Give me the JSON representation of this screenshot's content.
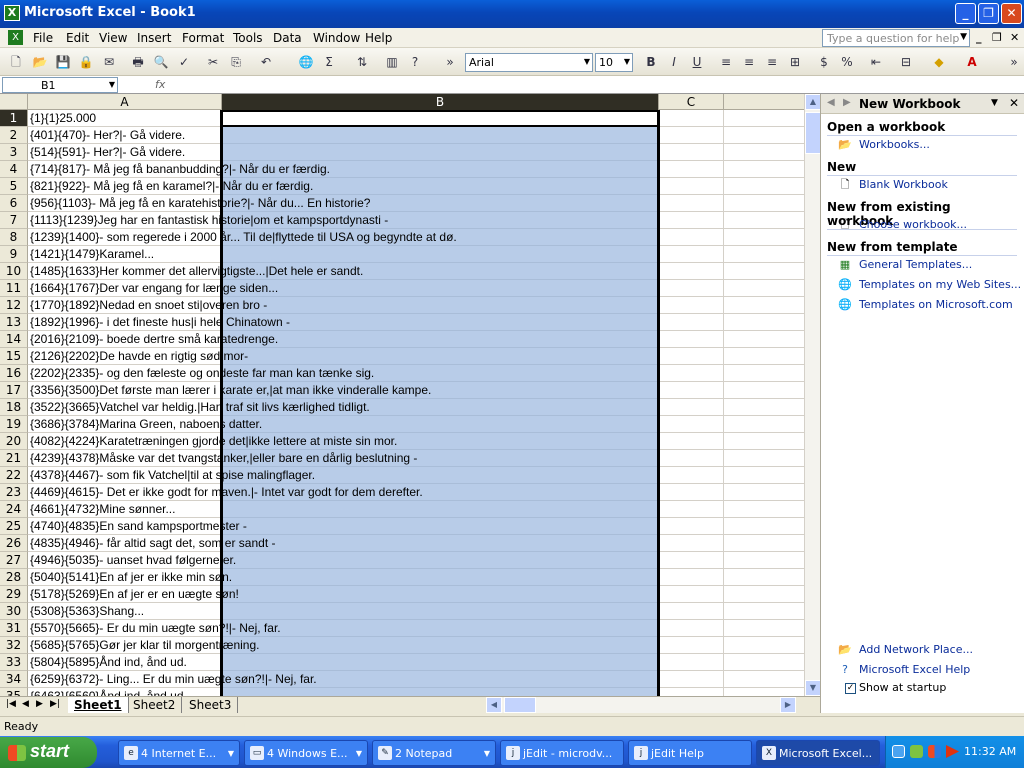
{
  "window": {
    "title": "Microsoft Excel - Book1"
  },
  "menu": [
    "File",
    "Edit",
    "View",
    "Insert",
    "Format",
    "Tools",
    "Data",
    "Window",
    "Help"
  ],
  "help_placeholder": "Type a question for help",
  "toolbar": {
    "font": "Arial",
    "size": "10"
  },
  "formula": {
    "cell": "B1"
  },
  "columns": [
    "A",
    "B",
    "C"
  ],
  "rows": [
    {
      "n": "1",
      "a": "{1}{1}25.000"
    },
    {
      "n": "2",
      "a": "{401}{470}- Her?|- Gå videre."
    },
    {
      "n": "3",
      "a": "{514}{591}- Her?|- Gå videre."
    },
    {
      "n": "4",
      "a": "{714}{817}- Må jeg få bananbudding?|- Når du er færdig."
    },
    {
      "n": "5",
      "a": "{821}{922}- Må jeg få en karamel?|- Når du er færdig."
    },
    {
      "n": "6",
      "a": "{956}{1103}- Må jeg få en karatehistorie?|- Når du... En historie?"
    },
    {
      "n": "7",
      "a": "{1113}{1239}Jeg har en fantastisk historie|om et kampsportdynasti -"
    },
    {
      "n": "8",
      "a": "{1239}{1400}- som regerede i 2000 år... Til de|flyttede til USA og begyndte at dø."
    },
    {
      "n": "9",
      "a": "{1421}{1479}Karamel..."
    },
    {
      "n": "10",
      "a": "{1485}{1633}Her kommer det allervigtigste...|Det hele er sandt."
    },
    {
      "n": "11",
      "a": "{1664}{1767}Der var engang for længe siden..."
    },
    {
      "n": "12",
      "a": "{1770}{1892}Nedad en snoet sti|overen bro -"
    },
    {
      "n": "13",
      "a": "{1892}{1996}- i det fineste hus|i hele Chinatown -"
    },
    {
      "n": "14",
      "a": "{2016}{2109}- boede dertre små karatedrenge."
    },
    {
      "n": "15",
      "a": "{2126}{2202}De havde en rigtig sød mor-"
    },
    {
      "n": "16",
      "a": "{2202}{2335}- og den fæleste og ondeste far man kan tænke sig."
    },
    {
      "n": "17",
      "a": "{3356}{3500}Det første man lærer i karate er,|at man ikke vinderalle kampe."
    },
    {
      "n": "18",
      "a": "{3522}{3665}Vatchel var heldig.|Han traf sit livs kærlighed tidligt."
    },
    {
      "n": "19",
      "a": "{3686}{3784}Marina Green, naboens datter."
    },
    {
      "n": "20",
      "a": "{4082}{4224}Karatetræningen gjorde det|ikke lettere at miste sin mor."
    },
    {
      "n": "21",
      "a": "{4239}{4378}Måske var det tvangstanker,|eller bare en dårlig beslutning -"
    },
    {
      "n": "22",
      "a": "{4378}{4467}- som fik Vatchel|til at spise malingflager."
    },
    {
      "n": "23",
      "a": "{4469}{4615}- Det er ikke godt for maven.|- Intet var godt for dem derefter."
    },
    {
      "n": "24",
      "a": "{4661}{4732}Mine sønner..."
    },
    {
      "n": "25",
      "a": "{4740}{4835}En sand kampsportmester -"
    },
    {
      "n": "26",
      "a": "{4835}{4946}- får altid sagt det, som er sandt -"
    },
    {
      "n": "27",
      "a": "{4946}{5035}- uanset hvad følgerne er."
    },
    {
      "n": "28",
      "a": "{5040}{5141}En af jer er ikke min søn."
    },
    {
      "n": "29",
      "a": "{5178}{5269}En af jer er en uægte søn!"
    },
    {
      "n": "30",
      "a": "{5308}{5363}Shang..."
    },
    {
      "n": "31",
      "a": "{5570}{5665}- Er du min uægte søn?!|- Nej, far."
    },
    {
      "n": "32",
      "a": "{5685}{5765}Gør jer klar til morgentræning."
    },
    {
      "n": "33",
      "a": "{5804}{5895}Ånd ind, ånd ud."
    },
    {
      "n": "34",
      "a": "{6259}{6372}- Ling... Er du min uægte søn?!|- Nej, far."
    },
    {
      "n": "35",
      "a": "{6463}{6560}Ånd ind, ånd ud."
    }
  ],
  "sheets": [
    "Sheet1",
    "Sheet2",
    "Sheet3"
  ],
  "status": "Ready",
  "taskpane": {
    "title": "New Workbook",
    "open_heading": "Open a workbook",
    "open_link": "Workbooks...",
    "new_heading": "New",
    "new_link": "Blank Workbook",
    "existing_heading": "New from existing workbook",
    "existing_link": "Choose workbook...",
    "template_heading": "New from template",
    "template_links": [
      "General Templates...",
      "Templates on my Web Sites...",
      "Templates on Microsoft.com"
    ],
    "bottom_links": [
      "Add Network Place...",
      "Microsoft Excel Help"
    ],
    "show_startup": "Show at startup"
  },
  "taskbar": {
    "start": "start",
    "tasks": [
      "4 Internet E...",
      "4 Windows E...",
      "2 Notepad",
      "jEdit - microdv...",
      "jEdit Help",
      "Microsoft Excel..."
    ],
    "clock": "11:32 AM"
  }
}
